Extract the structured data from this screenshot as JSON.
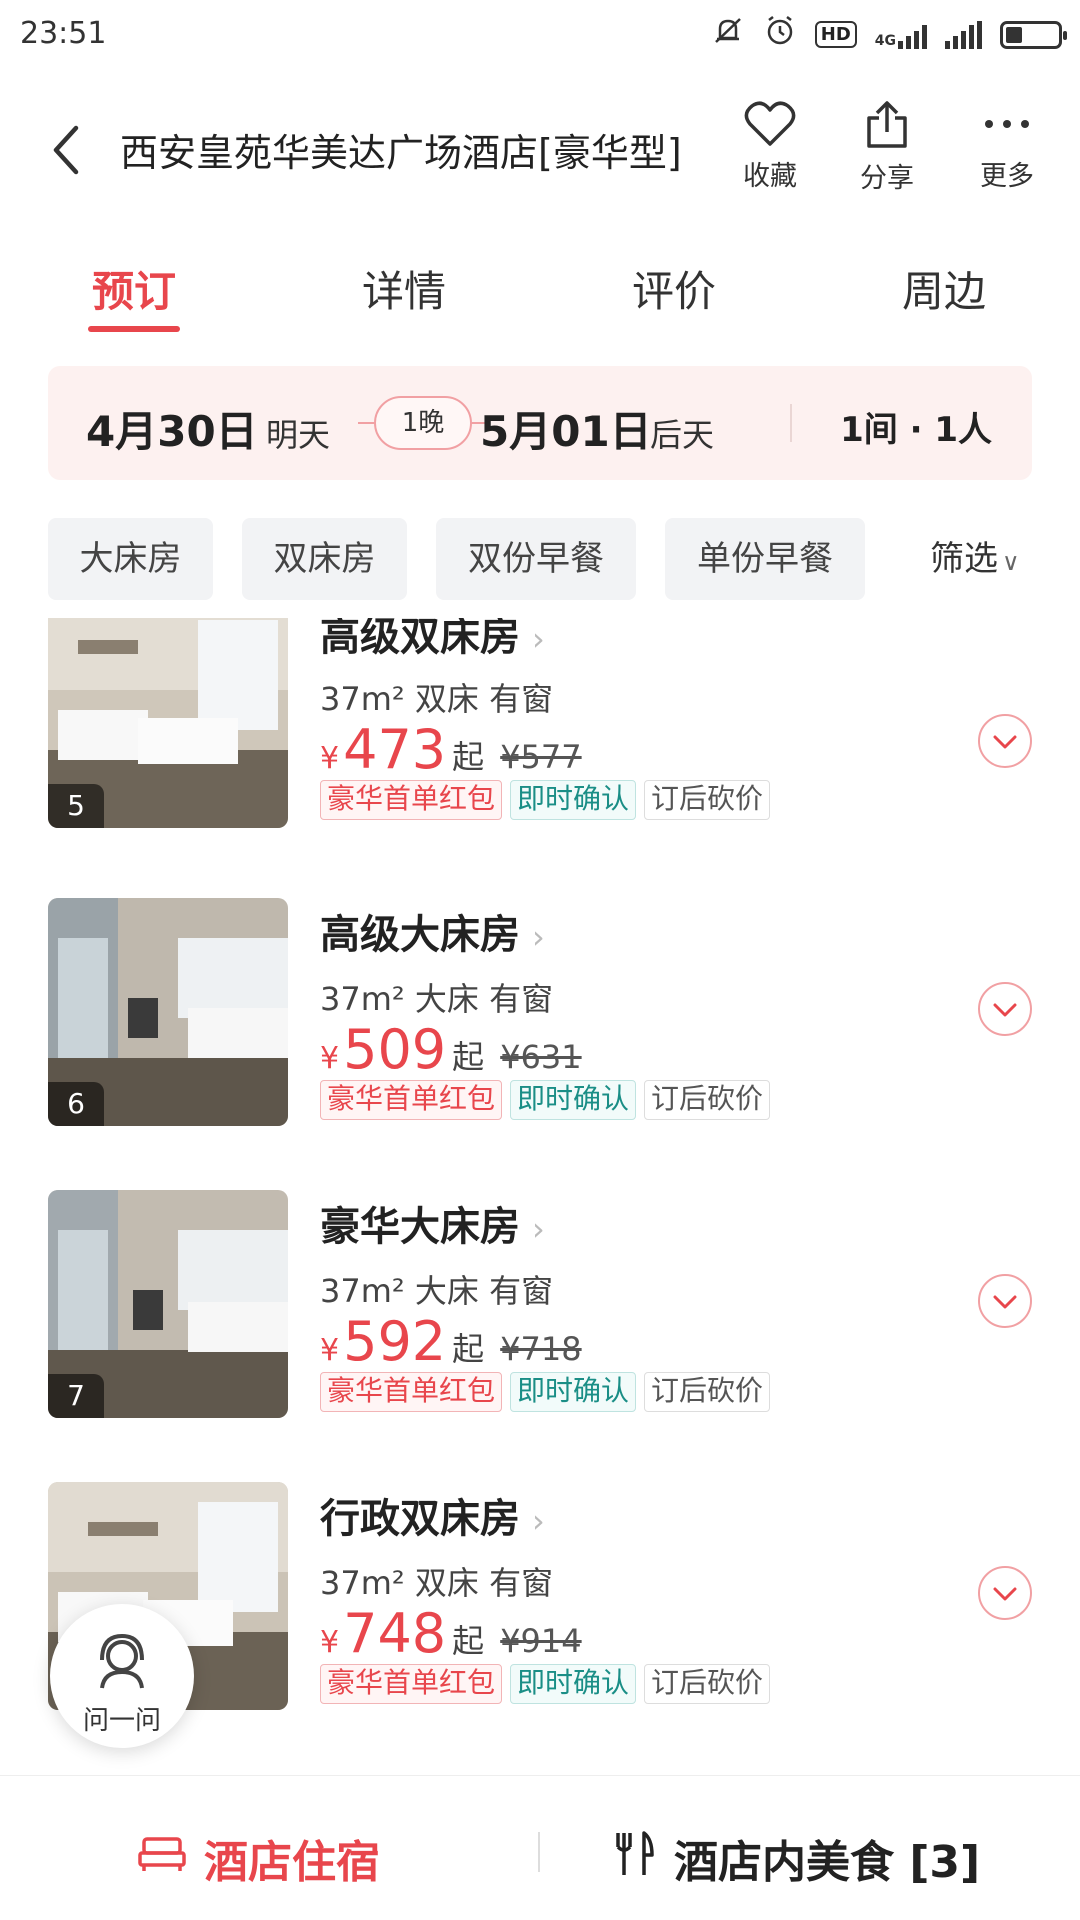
{
  "status_bar": {
    "time": "23:51",
    "network": "4G",
    "hd": "HD"
  },
  "header": {
    "title": "西安皇苑华美达广场酒店[豪华型]",
    "favorite_label": "收藏",
    "share_label": "分享",
    "more_label": "更多"
  },
  "tabs": [
    {
      "label": "预订",
      "active": true
    },
    {
      "label": "详情",
      "active": false
    },
    {
      "label": "评价",
      "active": false
    },
    {
      "label": "周边",
      "active": false
    }
  ],
  "dates": {
    "checkin_date": "4月30日",
    "checkin_day": "明天",
    "nights": "1晚",
    "checkout_date": "5月01日",
    "checkout_day": "后天",
    "rooms_guests": "1间 · 1人"
  },
  "filters": {
    "chips": [
      "大床房",
      "双床房",
      "双份早餐",
      "单份早餐"
    ],
    "filter_label": "筛选"
  },
  "rooms": [
    {
      "name": "高级双床房",
      "info": "37m² 双床 有窗",
      "currency": "¥",
      "price": "473",
      "from": "起",
      "original": "¥577",
      "photo_index": "5",
      "tags": [
        "豪华首单红包",
        "即时确认",
        "订后砍价"
      ]
    },
    {
      "name": "高级大床房",
      "info": "37m² 大床 有窗",
      "currency": "¥",
      "price": "509",
      "from": "起",
      "original": "¥631",
      "photo_index": "6",
      "tags": [
        "豪华首单红包",
        "即时确认",
        "订后砍价"
      ]
    },
    {
      "name": "豪华大床房",
      "info": "37m² 大床 有窗",
      "currency": "¥",
      "price": "592",
      "from": "起",
      "original": "¥718",
      "photo_index": "7",
      "tags": [
        "豪华首单红包",
        "即时确认",
        "订后砍价"
      ]
    },
    {
      "name": "行政双床房",
      "info": "37m² 双床 有窗",
      "currency": "¥",
      "price": "748",
      "from": "起",
      "original": "¥914",
      "photo_index": "",
      "tags": [
        "豪华首单红包",
        "即时确认",
        "订后砍价"
      ]
    }
  ],
  "ask": {
    "label": "问一问"
  },
  "bottom_bar": {
    "left_label": "酒店住宿",
    "right_label": "酒店内美食 [3]"
  },
  "colors": {
    "accent": "#e8464c",
    "teal": "#1a8e86",
    "date_bg": "#fdf1f0"
  }
}
